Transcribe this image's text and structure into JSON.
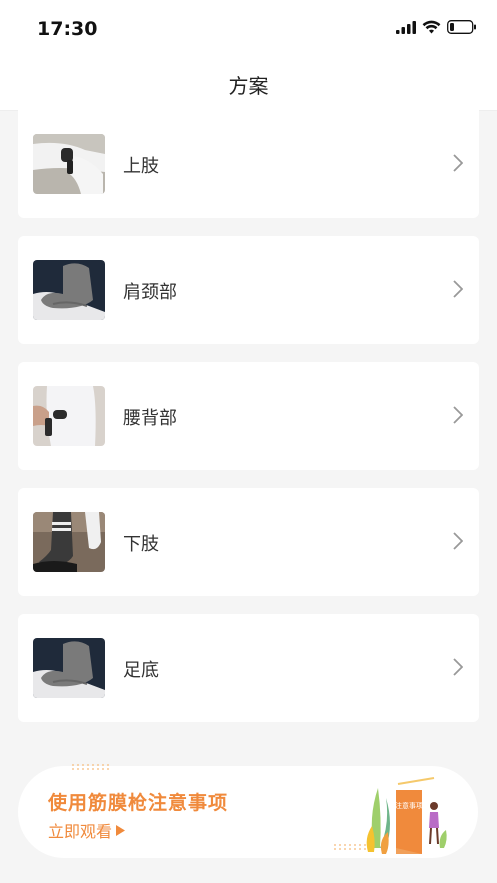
{
  "status": {
    "time": "17:30"
  },
  "nav": {
    "title": "方案"
  },
  "items": [
    {
      "label": "上肢",
      "thumb": "upper-limb-massage-photo"
    },
    {
      "label": "肩颈部",
      "thumb": "shoulder-neck-photo"
    },
    {
      "label": "腰背部",
      "thumb": "lower-back-massage-photo"
    },
    {
      "label": "下肢",
      "thumb": "lower-limb-photo"
    },
    {
      "label": "足底",
      "thumb": "sole-photo"
    }
  ],
  "banner": {
    "title": "使用筋膜枪注意事项",
    "link": "立即观看",
    "sign_text": "注意事项",
    "accent": "#f08a3c"
  }
}
